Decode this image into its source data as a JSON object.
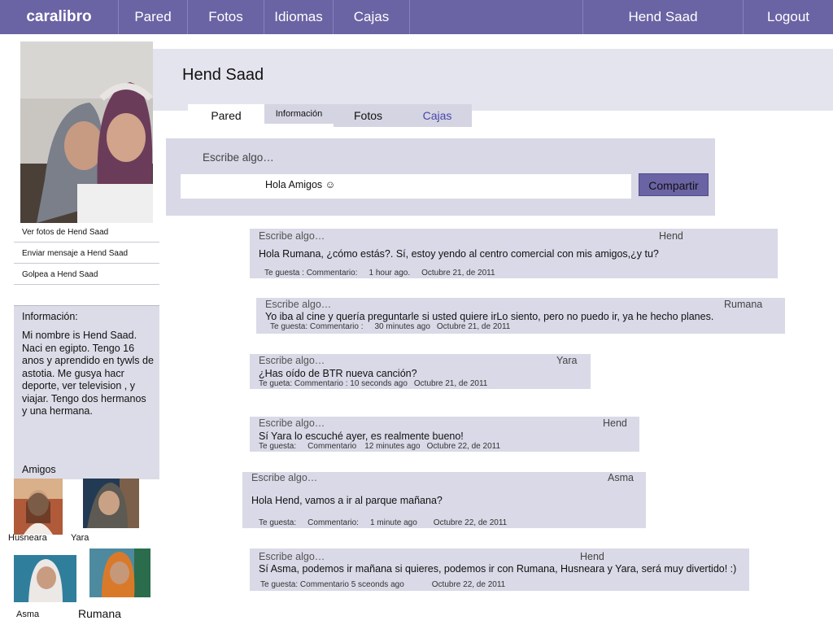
{
  "nav": {
    "brand": "caralibro",
    "items": [
      "Pared",
      "Fotos",
      "Idiomas",
      "Cajas"
    ],
    "user": "Hend Saad",
    "logout": "Logout"
  },
  "profile": {
    "name": "Hend Saad",
    "tabs": [
      "Pared",
      "Información",
      "Fotos",
      "Cajas"
    ]
  },
  "composer": {
    "prompt": "Escribe algo…",
    "input_value": "Hola Amigos ☺",
    "share_label": "Compartir"
  },
  "sidebar": {
    "links": [
      "Ver fotos de Hend Saad",
      "Enviar mensaje a Hend Saad",
      "Golpea a Hend Saad"
    ],
    "info_title": "Información:",
    "info_text": "Mi nombre is Hend Saad. Naci en egipto. Tengo 16 anos y aprendido en tywls de astotia. Me gusya hacr deporte, ver television , y viajar. Tengo dos hermanos y una hermana.",
    "friends_title": "Amigos",
    "friends": [
      "Husneara",
      "Yara",
      "Asma",
      "Rumana"
    ]
  },
  "posts": [
    {
      "placeholder": "Escribe algo…",
      "author": "Hend",
      "text": "Hola Rumana, ¿cómo estás?. Sí, estoy yendo al centro comercial con mis amigos,¿y tu?",
      "meta": [
        "Te guesta : Commentario:",
        "1 hour ago.",
        "Octubre 21, de 2011"
      ]
    },
    {
      "placeholder": "Escribe algo…",
      "author": "Rumana",
      "text": "Yo iba al cine y quería preguntarle si usted quiere irLo siento, pero no puedo ir, ya he hecho planes.",
      "meta": [
        "Te guesta: Commentario :",
        "30 minutes ago",
        "Octubre 21, de 2011"
      ]
    },
    {
      "placeholder": "Escribe algo…",
      "author": "Yara",
      "text": " ¿Has oído de BTR nueva canción?",
      "meta": [
        "Te gueta:  Commentario  : 10 seconds ago",
        "Octubre 21,  de 2011"
      ]
    },
    {
      "placeholder": "Escribe algo…",
      "author": "Hend",
      "text": "Sí Yara lo escuché ayer, es realmente bueno!",
      "meta": [
        "Te guesta:",
        "Commentario",
        "12  minutes ago",
        "Octubre 22, de 2011"
      ]
    },
    {
      "placeholder": "Escribe algo…",
      "author": "Asma",
      "text": "Hola Hend, vamos a ir al parque mañana?",
      "meta": [
        "Te guesta:",
        "Commentario:",
        "1 minute ago",
        "Octubre 22, de 2011"
      ]
    },
    {
      "placeholder": "Escribe algo…",
      "author": "Hend",
      "text": "Sí Asma, podemos ir mañana si quieres, podemos ir con Rumana, Husneara y Yara, será muy divertido! :)",
      "meta": [
        "Te guesta: Commentario 5 sceonds ago",
        "Octubre 22, de 2011"
      ]
    }
  ],
  "colors": {
    "accent": "#6a63a4",
    "panel": "#d9d9e7",
    "link_tab": "#4a44a8"
  }
}
